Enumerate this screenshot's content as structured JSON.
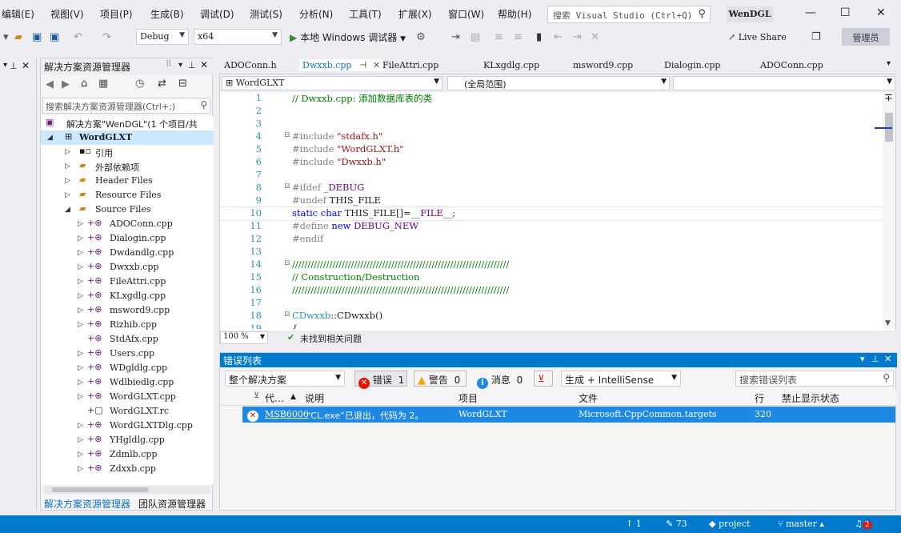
{
  "menu": [
    "编辑(E)",
    "视图(V)",
    "项目(P)",
    "生成(B)",
    "调试(D)",
    "测试(S)",
    "分析(N)",
    "工具(T)",
    "扩展(X)",
    "窗口(W)",
    "帮助(H)"
  ],
  "search": {
    "placeholder": "搜索 Visual Studio (Ctrl+Q)"
  },
  "solution_name": "WenDGL",
  "toolbar": {
    "config": "Debug",
    "platform": "x64",
    "run_label": "本地 Windows 调试器",
    "liveshare": "Live Share",
    "admin": "管理员"
  },
  "solution_explorer": {
    "title": "解决方案资源管理器",
    "search_placeholder": "搜索解决方案资源管理器(Ctrl+;)",
    "solution_label": "解决方案\"WenDGL\"(1 个项目/共",
    "project": "WordGLXT",
    "nodes": [
      "引用",
      "外部依赖项",
      "Header Files",
      "Resource Files",
      "Source Files"
    ],
    "files": [
      "ADOConn.cpp",
      "Dialogin.cpp",
      "Dwdandlg.cpp",
      "Dwxxb.cpp",
      "FileAttri.cpp",
      "KLxgdlg.cpp",
      "msword9.cpp",
      "Rizhib.cpp",
      "StdAfx.cpp",
      "Users.cpp",
      "WDgldlg.cpp",
      "Wdlbiedlg.cpp",
      "WordGLXT.cpp",
      "WordGLXT.rc",
      "WordGLXTDlg.cpp",
      "YHgldlg.cpp",
      "Zdmlb.cpp",
      "Zdxxb.cpp"
    ],
    "tab_solution": "解决方案资源管理器",
    "tab_team": "团队资源管理器"
  },
  "doc_tabs": [
    "ADOConn.h",
    "Dwxxb.cpp",
    "FileAttri.cpp",
    "KLxgdlg.cpp",
    "msword9.cpp",
    "Dialogin.cpp",
    "ADOConn.cpp"
  ],
  "nav": {
    "project": "WordGLXT",
    "scope": "(全局范围)"
  },
  "code": [
    {
      "n": "1",
      "t": "// Dwxxb.cpp: 添加数据库表的类",
      "c": "c-comment"
    },
    {
      "n": "2",
      "t": "",
      "c": ""
    },
    {
      "n": "3",
      "t": "",
      "c": ""
    },
    {
      "n": "4",
      "t": "#include \"stdafx.h\"",
      "c": "inc"
    },
    {
      "n": "5",
      "t": "#include \"WordGLXT.h\"",
      "c": "inc"
    },
    {
      "n": "6",
      "t": "#include \"Dwxxb.h\"",
      "c": "inc"
    },
    {
      "n": "7",
      "t": "",
      "c": ""
    },
    {
      "n": "8",
      "t": "#ifdef _DEBUG",
      "c": "ifdef"
    },
    {
      "n": "9",
      "t": "#undef THIS_FILE",
      "c": "undef"
    },
    {
      "n": "10",
      "t": "static char THIS_FILE[]=__FILE__;",
      "c": "static"
    },
    {
      "n": "11",
      "t": "#define new DEBUG_NEW",
      "c": "define"
    },
    {
      "n": "12",
      "t": "#endif",
      "c": "c-pre"
    },
    {
      "n": "13",
      "t": "",
      "c": ""
    },
    {
      "n": "14",
      "t": "//////////////////////////////////////////////////////////////////////",
      "c": "c-comment"
    },
    {
      "n": "15",
      "t": "// Construction/Destruction",
      "c": "c-comment"
    },
    {
      "n": "16",
      "t": "//////////////////////////////////////////////////////////////////////",
      "c": "c-comment"
    },
    {
      "n": "17",
      "t": "",
      "c": ""
    },
    {
      "n": "18",
      "t": "CDwxxb::CDwxxb()",
      "c": "ctor"
    },
    {
      "n": "19",
      "t": "{",
      "c": ""
    }
  ],
  "zoom": "100 %",
  "issues_status": "未找到相关问题",
  "error_list": {
    "title": "错误列表",
    "scope": "整个解决方案",
    "errors_label": "错误",
    "errors_count": "1",
    "warnings_label": "警告",
    "warnings_count": "0",
    "messages_label": "消息",
    "messages_count": "0",
    "build_filter": "生成 + IntelliSense",
    "search_placeholder": "搜索错误列表",
    "columns": [
      "代…",
      "说明",
      "项目",
      "文件",
      "行",
      "禁止显示状态"
    ],
    "row": {
      "code": "MSB6006",
      "desc": "“CL.exe”已退出，代码为 2。",
      "project": "WordGLXT",
      "file": "Microsoft.CppCommon.targets",
      "line": "320"
    }
  },
  "status": {
    "up": "1",
    "edits": "73",
    "repo": "project",
    "branch": "master",
    "notif": "2"
  },
  "colors": {
    "accent": "#007acc",
    "selection": "#1e88e5"
  }
}
